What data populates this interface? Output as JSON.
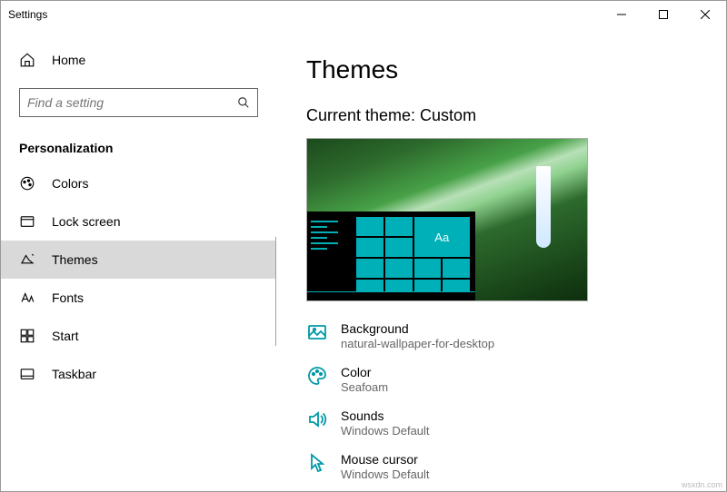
{
  "window": {
    "title": "Settings"
  },
  "sidebar": {
    "home": "Home",
    "search_placeholder": "Find a setting",
    "section": "Personalization",
    "items": [
      {
        "label": "Colors"
      },
      {
        "label": "Lock screen"
      },
      {
        "label": "Themes"
      },
      {
        "label": "Fonts"
      },
      {
        "label": "Start"
      },
      {
        "label": "Taskbar"
      }
    ]
  },
  "main": {
    "title": "Themes",
    "current_theme_heading": "Current theme: Custom",
    "preview_tile_text": "Aa",
    "settings": [
      {
        "label": "Background",
        "value": "natural-wallpaper-for-desktop"
      },
      {
        "label": "Color",
        "value": "Seafoam"
      },
      {
        "label": "Sounds",
        "value": "Windows Default"
      },
      {
        "label": "Mouse cursor",
        "value": "Windows Default"
      }
    ]
  },
  "watermark": "wsxdn.com"
}
